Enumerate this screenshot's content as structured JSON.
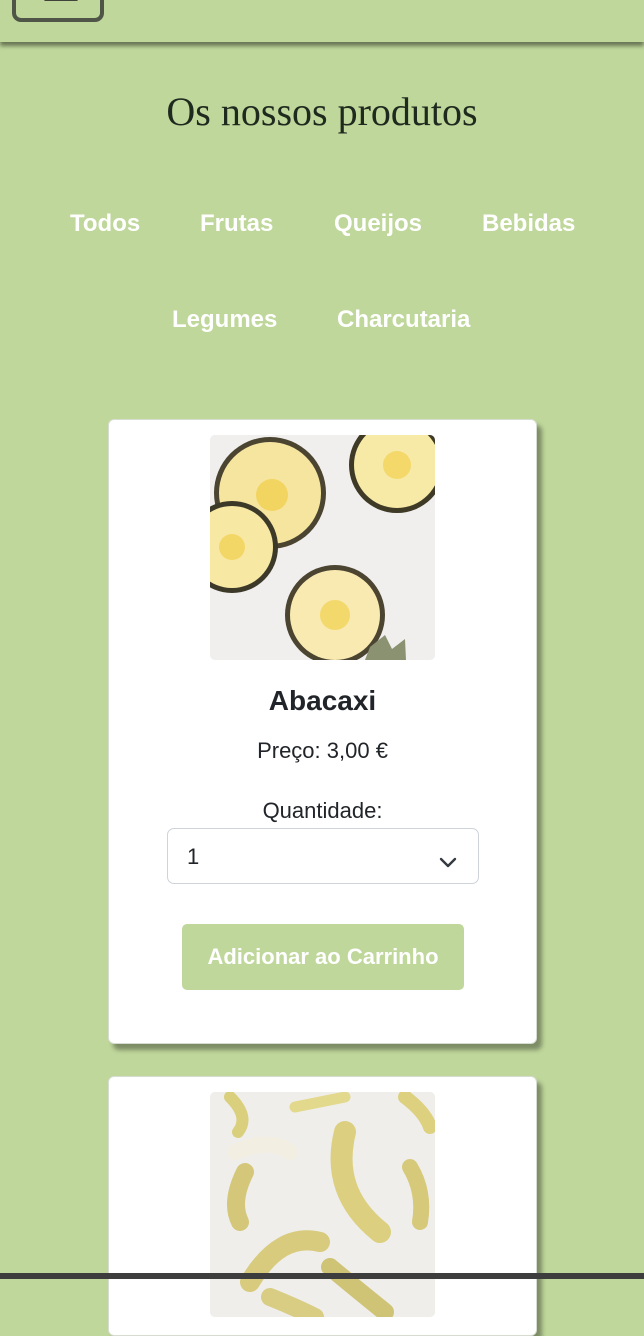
{
  "header": {
    "menu_icon": "hamburger-icon"
  },
  "page_title": "Os nossos produtos",
  "filters": [
    "Todos",
    "Frutas",
    "Queijos",
    "Bebidas",
    "Legumes",
    "Charcutaria"
  ],
  "colors": {
    "accent": "#bfd79b",
    "text": "#212529",
    "card": "#ffffff"
  },
  "products": [
    {
      "name": "Abacaxi",
      "price": "Preço: 3,00 €",
      "quantity_label": "Quantidade:",
      "quantity_value": "1",
      "button_label": "Adicionar ao Carrinho",
      "image_icon": "pineapple-slices-image"
    },
    {
      "image_icon": "bananas-image"
    }
  ]
}
